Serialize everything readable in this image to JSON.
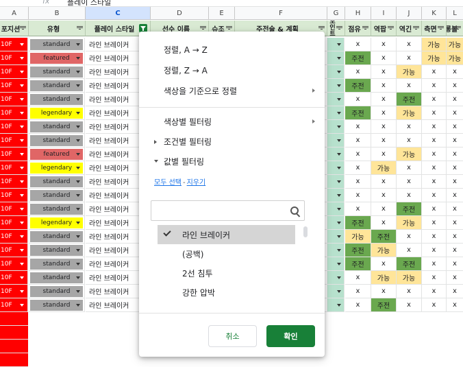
{
  "formula_bar": {
    "fx": "fx",
    "text": "플레이 스타일"
  },
  "col_letters": [
    "A",
    "B",
    "C",
    "D",
    "E",
    "F",
    "G",
    "H",
    "I",
    "J",
    "K",
    "L"
  ],
  "selected_col": "C",
  "headers": [
    "포지션",
    "유형",
    "플레이 스타일",
    "선수 이름",
    "슈조",
    "주전술 & 계획",
    "재능포인트 소지",
    "점유",
    "역팝",
    "역긴",
    "측면",
    "롱볼"
  ],
  "rows": [
    {
      "a": "10F",
      "type": "standard",
      "style": "라인 브레이커",
      "marks": [
        "x",
        "x",
        "x",
        "가능",
        "가능"
      ]
    },
    {
      "a": "10F",
      "type": "featured",
      "style": "라인 브레이커",
      "marks": [
        "주전",
        "x",
        "x",
        "가능",
        "가능"
      ]
    },
    {
      "a": "10F",
      "type": "standard",
      "style": "라인 브레이커",
      "marks": [
        "x",
        "x",
        "가능",
        "x",
        "x"
      ]
    },
    {
      "a": "10F",
      "type": "standard",
      "style": "라인 브레이커",
      "marks": [
        "주전",
        "x",
        "x",
        "x",
        "x"
      ]
    },
    {
      "a": "10F",
      "type": "standard",
      "style": "라인 브레이커",
      "marks": [
        "x",
        "x",
        "주전",
        "x",
        "x"
      ]
    },
    {
      "a": "10F",
      "type": "legendary",
      "style": "라인 브레이커",
      "marks": [
        "주전",
        "x",
        "가능",
        "x",
        "x"
      ]
    },
    {
      "a": "10F",
      "type": "standard",
      "style": "라인 브레이커",
      "marks": [
        "x",
        "x",
        "x",
        "x",
        "x"
      ]
    },
    {
      "a": "10F",
      "type": "standard",
      "style": "라인 브레이커",
      "marks": [
        "x",
        "x",
        "x",
        "x",
        "x"
      ]
    },
    {
      "a": "10F",
      "type": "featured",
      "style": "라인 브레이커",
      "marks": [
        "x",
        "x",
        "가능",
        "x",
        "x"
      ]
    },
    {
      "a": "10F",
      "type": "legendary",
      "style": "라인 브레이커",
      "marks": [
        "x",
        "가능",
        "x",
        "x",
        "x"
      ]
    },
    {
      "a": "10F",
      "type": "standard",
      "style": "라인 브레이커",
      "marks": [
        "x",
        "x",
        "x",
        "x",
        "x"
      ]
    },
    {
      "a": "10F",
      "type": "standard",
      "style": "라인 브레이커",
      "marks": [
        "x",
        "x",
        "x",
        "x",
        "x"
      ]
    },
    {
      "a": "10F",
      "type": "standard",
      "style": "라인 브레이커",
      "marks": [
        "x",
        "x",
        "주전",
        "x",
        "x"
      ]
    },
    {
      "a": "10F",
      "type": "legendary",
      "style": "라인 브레이커",
      "marks": [
        "주전",
        "x",
        "가능",
        "x",
        "x"
      ]
    },
    {
      "a": "10F",
      "type": "standard",
      "style": "라인 브레이커",
      "marks": [
        "가능",
        "주전",
        "x",
        "x",
        "x"
      ]
    },
    {
      "a": "10F",
      "type": "standard",
      "style": "라인 브레이커",
      "marks": [
        "주전",
        "가능",
        "x",
        "x",
        "x"
      ]
    },
    {
      "a": "10F",
      "type": "standard",
      "style": "라인 브레이커",
      "marks": [
        "주전",
        "x",
        "주전",
        "x",
        "x"
      ]
    },
    {
      "a": "10F",
      "type": "standard",
      "style": "라인 브레이커",
      "marks": [
        "x",
        "가능",
        "가능",
        "x",
        "x"
      ]
    },
    {
      "a": "10F",
      "type": "standard",
      "style": "라인 브레이커",
      "marks": [
        "x",
        "x",
        "x",
        "x",
        "x"
      ]
    },
    {
      "a": "10F",
      "type": "standard",
      "style": "라인 브레이커",
      "marks": [
        "x",
        "주전",
        "x",
        "x",
        "x"
      ]
    }
  ],
  "colors": {
    "pos_red": "#ff0000",
    "standard": "#a6a6a6",
    "featured": "#e06666",
    "legendary": "#ffff00",
    "주전": "#6aa84f",
    "가능": "#ffe599",
    "header_green": "#d9ead3",
    "accent_green": "#188038"
  },
  "menu": {
    "sort_az": "정렬, A → Z",
    "sort_za": "정렬, Z → A",
    "sort_color": "색상을 기준으로 정렬",
    "filter_color": "색상별 필터링",
    "filter_condition": "조건별 필터링",
    "filter_value": "값별 필터링",
    "select_all": "모두 선택",
    "clear": "지우기",
    "search_placeholder": "",
    "values": [
      {
        "label": "라인 브레이커",
        "checked": true
      },
      {
        "label": "(공백)",
        "checked": false
      },
      {
        "label": "2선 침투",
        "checked": false
      },
      {
        "label": "강한 압박",
        "checked": false
      }
    ],
    "cancel": "취소",
    "ok": "확인"
  }
}
